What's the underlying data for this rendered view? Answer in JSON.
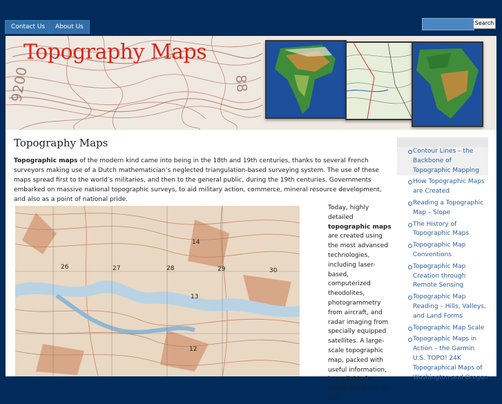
{
  "nav": {
    "contact_label": "Contact Us",
    "about_label": "About Us"
  },
  "search": {
    "placeholder": "",
    "button_label": "Search"
  },
  "banner": {
    "title": "Topography Maps"
  },
  "main": {
    "title": "Topography Maps",
    "intro_bold": "Topographic maps",
    "intro_rest": " of the modern kind came into being in the 18th and 19th centuries, thanks to several French surveyors making use of a Dutch mathematician’s neglected triangulation-based surveying system. The use of these maps spread first to the world’s militaries, and then to the general public, during the 19th centuries. Governments embarked on massive national topographic surveys, to aid military action, commerce, mineral resource development, and also as a point of national pride.",
    "side_pre": "Today, highly detailed ",
    "side_bold": "topographic maps",
    "side_post": " are created using the most advanced technologies, including laser-based, computerized theodolites, photogrammetry from aircraft, and radar imaging from specially equipped satellites. A large-scale topographic map, packed with useful information, is available for nearly any point on the"
  },
  "sidebar": {
    "items": [
      {
        "label": "Contour Lines – the Backbone of Topographic Mapping"
      },
      {
        "label": "How Topographic Maps are Created"
      },
      {
        "label": "Reading a Topographic Map – Slope"
      },
      {
        "label": "The History of Topographic Maps"
      },
      {
        "label": "Topographic Map Conventions"
      },
      {
        "label": "Topographic Map Creation through Remote Sensing"
      },
      {
        "label": "Topographic Map Reading – Hills, Valleys, and Land Forms"
      },
      {
        "label": "Topographic Map Scale"
      },
      {
        "label": "Topographic Maps in Action – the Garmin U.S. TOPO! 24K Topographical Maps of Washington and Oregon"
      }
    ]
  },
  "map_labels": [
    "14",
    "26",
    "27",
    "28",
    "29",
    "30",
    "13",
    "12"
  ],
  "colors": {
    "background": "#002b5a",
    "nav_button": "#2f6ea8",
    "banner_title": "#d9261c",
    "link": "#2f5e9e"
  }
}
